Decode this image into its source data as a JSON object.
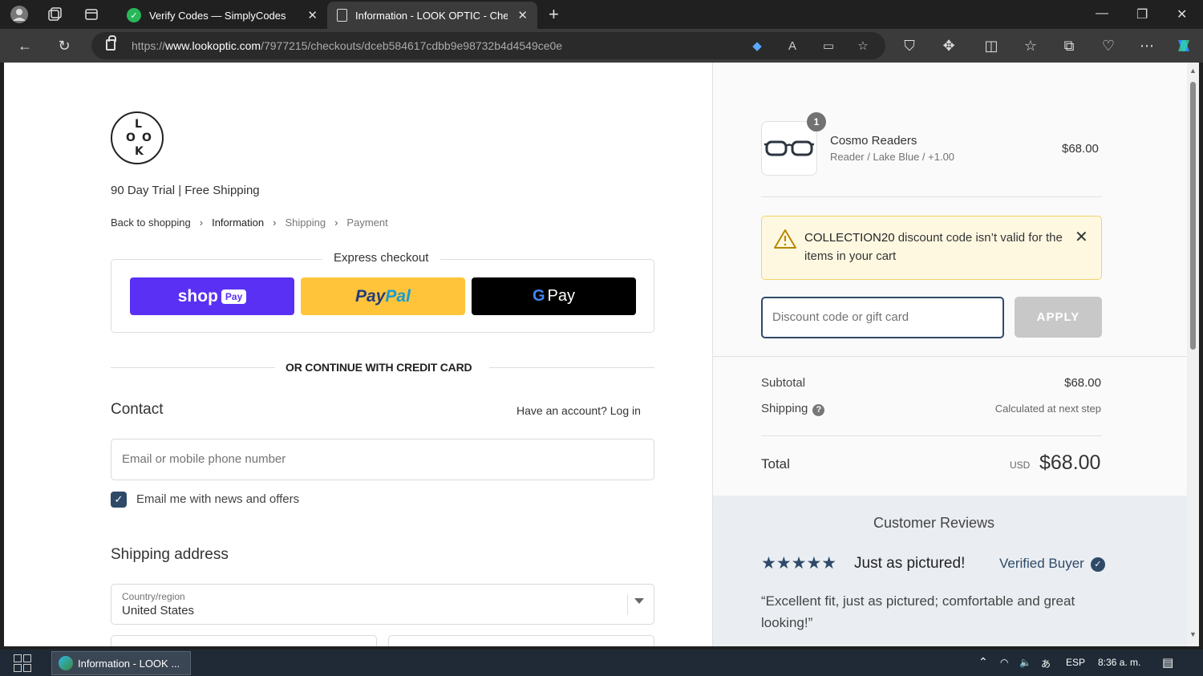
{
  "browser": {
    "tabs": [
      {
        "title": "Verify Codes — SimplyCodes",
        "active": false
      },
      {
        "title": "Information - LOOK OPTIC - Checkout",
        "active": true
      }
    ],
    "url_prefix": "https://",
    "url_domain": "www.lookoptic.com",
    "url_path": "/7977215/checkouts/dceb584617cdbb9e98732b4d4549ce0e"
  },
  "checkout": {
    "logo_letters": [
      "L",
      "O",
      "O",
      "K"
    ],
    "tagline": "90 Day Trial | Free Shipping",
    "breadcrumb": [
      "Back to shopping",
      "Information",
      "Shipping",
      "Payment"
    ],
    "express_title": "Express checkout",
    "shop_label": "shop",
    "shop_pill": "Pay",
    "paypal_a": "Pay",
    "paypal_b": "Pal",
    "gpay_g": "G",
    "gpay_label": "Pay",
    "divider_text": "OR CONTINUE WITH CREDIT CARD",
    "contact_heading": "Contact",
    "login_prompt": "Have an account? Log in",
    "email_placeholder": "Email me with news and offers",
    "email_field_placeholder": "Email or mobile phone number",
    "shipping_heading": "Shipping address",
    "country_label": "Country/region",
    "country_value": "United States"
  },
  "summary": {
    "item": {
      "qty": "1",
      "name": "Cosmo Readers",
      "variant": "Reader / Lake Blue / +1.00",
      "price": "$68.00"
    },
    "alert_code": "COLLECTION20",
    "alert_text": " discount code isn’t valid for the items in your cart",
    "discount_placeholder": "Discount code or gift card",
    "apply_label": "APPLY",
    "subtotal_label": "Subtotal",
    "subtotal_value": "$68.00",
    "shipping_label": "Shipping",
    "shipping_value": "Calculated at next step",
    "total_label": "Total",
    "total_currency": "USD",
    "total_value": "$68.00",
    "reviews_title": "Customer Reviews",
    "review_stars": "★★★★★",
    "review_rating": 5,
    "review_headline": "Just as pictured!",
    "review_badge": "Verified Buyer",
    "review_body": "“Excellent fit, just as pictured; comfortable and great looking!”"
  },
  "taskbar": {
    "app_label": "Information - LOOK ...",
    "lang": "ESP",
    "clock": "8:36 a. m."
  },
  "colors": {
    "accent": "#2f4a68",
    "shop_pay": "#5a31f4",
    "paypal": "#ffc439",
    "alert_bg": "#fff8e1"
  }
}
